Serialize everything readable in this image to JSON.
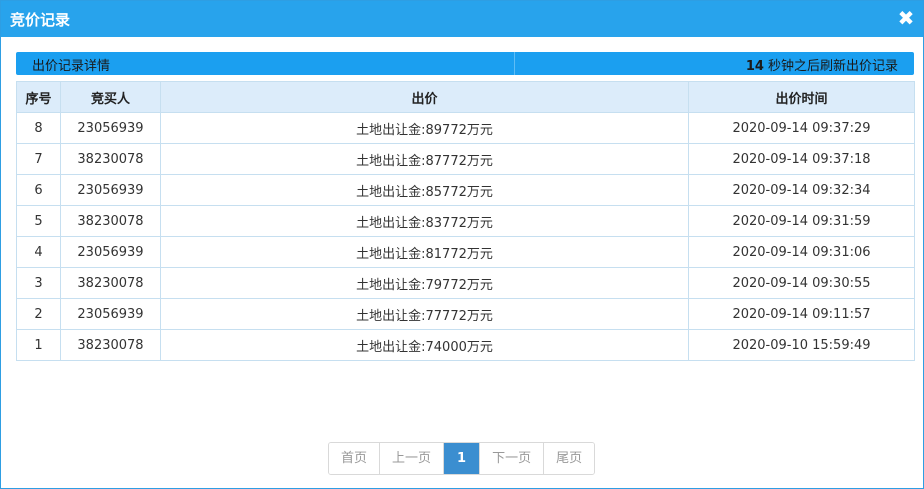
{
  "window": {
    "title": "竞价记录"
  },
  "infobar": {
    "left_label": "出价记录详情",
    "refresh_seconds": "14",
    "refresh_text": "秒钟之后刷新出价记录"
  },
  "table": {
    "headers": [
      "序号",
      "竞买人",
      "出价",
      "出价时间"
    ],
    "rows": [
      [
        "8",
        "23056939",
        "土地出让金:89772万元",
        "2020-09-14 09:37:29"
      ],
      [
        "7",
        "38230078",
        "土地出让金:87772万元",
        "2020-09-14 09:37:18"
      ],
      [
        "6",
        "23056939",
        "土地出让金:85772万元",
        "2020-09-14 09:32:34"
      ],
      [
        "5",
        "38230078",
        "土地出让金:83772万元",
        "2020-09-14 09:31:59"
      ],
      [
        "4",
        "23056939",
        "土地出让金:81772万元",
        "2020-09-14 09:31:06"
      ],
      [
        "3",
        "38230078",
        "土地出让金:79772万元",
        "2020-09-14 09:30:55"
      ],
      [
        "2",
        "23056939",
        "土地出让金:77772万元",
        "2020-09-14 09:11:57"
      ],
      [
        "1",
        "38230078",
        "土地出让金:74000万元",
        "2020-09-10 15:59:49"
      ]
    ]
  },
  "pager": {
    "first": "首页",
    "prev": "上一页",
    "current": "1",
    "next": "下一页",
    "last": "尾页"
  },
  "colors": {
    "titlebar": "#28a3ec",
    "infobar": "#1b9ff0",
    "header_bg": "#dcecfa",
    "active_page": "#3b8ed0"
  }
}
